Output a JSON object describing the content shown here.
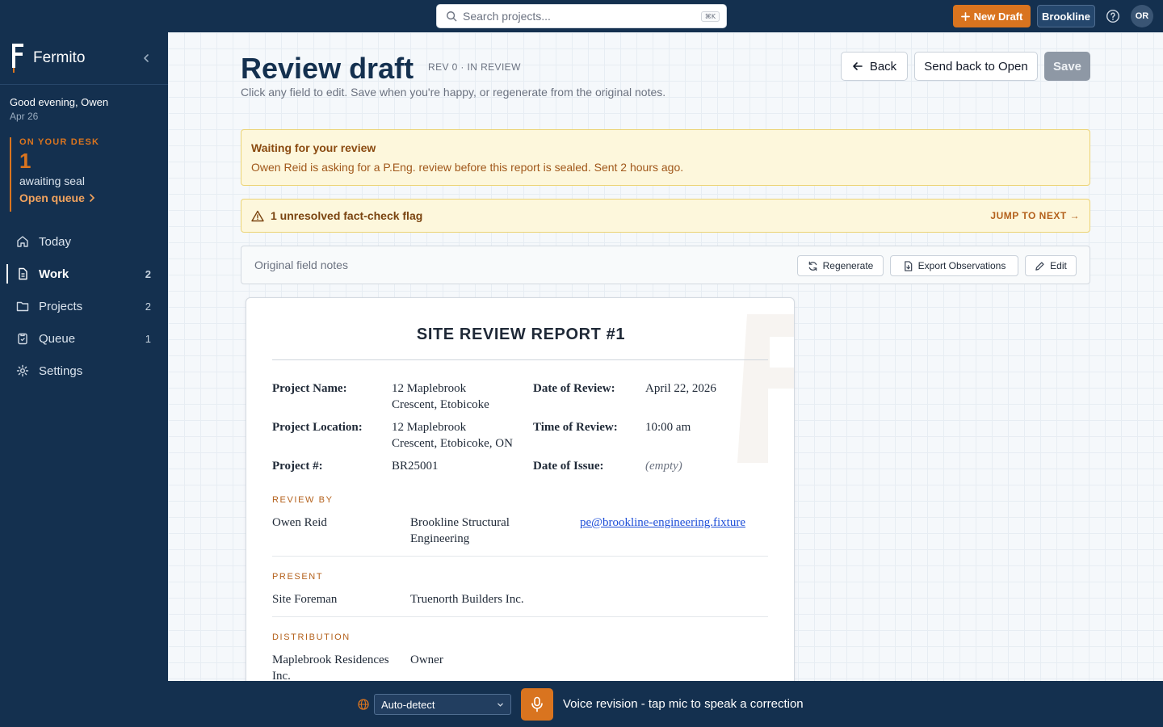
{
  "topbar": {
    "search_placeholder": "Search projects...",
    "search_shortcut": "⌘K",
    "new_draft_label": "New Draft",
    "org_label": "Brookline",
    "avatar_initials": "OR"
  },
  "sidebar": {
    "brand": "Fermito",
    "greeting": "Good evening, Owen",
    "date": "Apr 26",
    "desk": {
      "label": "ON YOUR DESK",
      "count": "1",
      "sub": "awaiting seal",
      "link": "Open queue"
    },
    "nav": [
      {
        "label": "Today",
        "count": "",
        "icon": "home-icon"
      },
      {
        "label": "Work",
        "count": "2",
        "icon": "document-icon",
        "active": true
      },
      {
        "label": "Projects",
        "count": "2",
        "icon": "folder-icon"
      },
      {
        "label": "Queue",
        "count": "1",
        "icon": "clipboard-icon"
      },
      {
        "label": "Settings",
        "count": "",
        "icon": "gear-icon"
      }
    ]
  },
  "header": {
    "title": "Review draft",
    "revision": "REV 0 · IN REVIEW",
    "subtitle": "Click any field to edit. Save when you're happy, or regenerate from the original notes.",
    "back_label": "Back",
    "send_back_label": "Send back to Open",
    "save_label": "Save"
  },
  "banner_waiting": {
    "title": "Waiting for your review",
    "text": "Owen Reid is asking for a P.Eng. review before this report is sealed. Sent 2 hours ago."
  },
  "banner_flag": {
    "text": "1 unresolved fact-check flag",
    "action": "JUMP TO NEXT →"
  },
  "notes_bar": {
    "label": "Original field notes",
    "regenerate_label": "Regenerate",
    "export_label": "Export Observations",
    "edit_label": "Edit"
  },
  "report": {
    "title": "SITE REVIEW REPORT #1",
    "fields": {
      "project_name_label": "Project Name:",
      "project_name_line1": "12 Maplebrook",
      "project_name_line2": "Crescent, Etobicoke",
      "date_review_label": "Date of Review:",
      "date_review": "April 22, 2026",
      "project_location_label": "Project Location:",
      "project_location_line1": "12 Maplebrook",
      "project_location_line2": "Crescent, Etobicoke, ON",
      "time_review_label": "Time of Review:",
      "time_review": "10:00 am",
      "project_num_label": "Project #:",
      "project_num": "BR25001",
      "date_issue_label": "Date of Issue:",
      "date_issue": "(empty)"
    },
    "review_by": {
      "label": "REVIEW BY",
      "name": "Owen Reid",
      "company_line1": "Brookline Structural",
      "company_line2": "Engineering",
      "email": "pe@brookline-engineering.fixture"
    },
    "present": {
      "label": "PRESENT",
      "role": "Site Foreman",
      "company": "Truenorth Builders Inc."
    },
    "distribution": {
      "label": "DISTRIBUTION",
      "name_line1": "Maplebrook Residences",
      "name_line2": "Inc.",
      "role": "Owner"
    }
  },
  "bottombar": {
    "language": "Auto-detect",
    "voice_text": "Voice revision - tap mic to speak a correction"
  },
  "colors": {
    "navy": "#14304f",
    "accent_orange": "#d9741f",
    "banner_bg": "#fdf7dc",
    "banner_border": "#ecd374"
  }
}
